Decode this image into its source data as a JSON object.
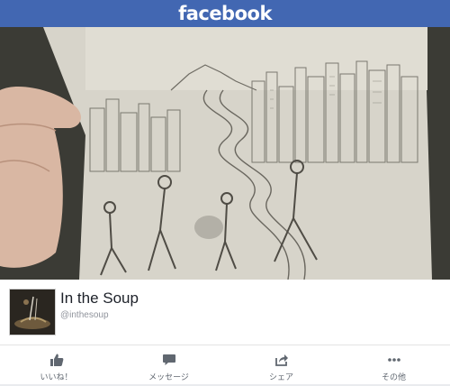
{
  "header": {
    "logo_text": "facebook",
    "bar_color": "#4267b2"
  },
  "profile": {
    "name": "In the Soup",
    "handle": "@inthesoup"
  },
  "actions": [
    {
      "label": "いいね！",
      "icon": "thumbs-up-icon"
    },
    {
      "label": "メッセージ",
      "icon": "chat-bubble-icon"
    },
    {
      "label": "シェア",
      "icon": "share-icon"
    },
    {
      "label": "その他",
      "icon": "more-dots-icon"
    }
  ]
}
